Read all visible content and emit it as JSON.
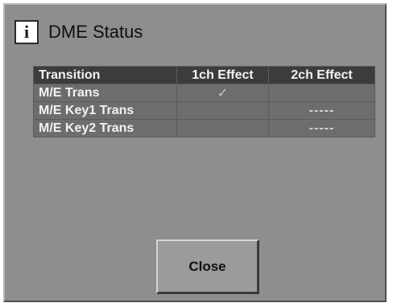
{
  "dialog": {
    "title": "DME Status",
    "icon": "info-icon"
  },
  "table": {
    "headers": [
      "Transition",
      "1ch Effect",
      "2ch Effect"
    ],
    "rows": [
      {
        "transition": "M/E Trans",
        "ch1": "✓",
        "ch2": ""
      },
      {
        "transition": "M/E Key1 Trans",
        "ch1": "",
        "ch2": "-----"
      },
      {
        "transition": "M/E Key2 Trans",
        "ch1": "",
        "ch2": "-----"
      }
    ]
  },
  "buttons": {
    "close_label": "Close"
  },
  "colors": {
    "panel_bg": "#8e8e8e",
    "header_bg": "#3c3c3c",
    "row_bg": "#6d6d6d",
    "text_light": "#f2f2f2"
  }
}
